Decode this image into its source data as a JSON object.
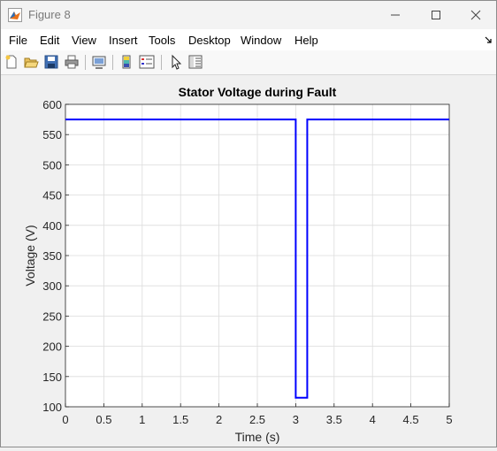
{
  "window": {
    "title": "Figure 8",
    "menu": [
      "File",
      "Edit",
      "View",
      "Insert",
      "Tools",
      "Desktop",
      "Window",
      "Help"
    ]
  },
  "toolbar": {
    "buttons": [
      "new-figure",
      "open-file",
      "save",
      "print",
      "link-figure",
      "insert-colorbar",
      "insert-legend",
      "edit-plot",
      "open-property-inspector"
    ]
  },
  "chart_data": {
    "type": "line",
    "title": "Stator Voltage during Fault",
    "xlabel": "Time (s)",
    "ylabel": "Voltage (V)",
    "xlim": [
      0,
      5
    ],
    "ylim": [
      100,
      600
    ],
    "xticks": [
      "0",
      "0.5",
      "1",
      "1.5",
      "2",
      "2.5",
      "3",
      "3.5",
      "4",
      "4.5",
      "5"
    ],
    "yticks": [
      "100",
      "150",
      "200",
      "250",
      "300",
      "350",
      "400",
      "450",
      "500",
      "550",
      "600"
    ],
    "grid": true,
    "series": [
      {
        "color": "#0000ff",
        "x": [
          0,
          3.0,
          3.0,
          3.15,
          3.15,
          5
        ],
        "y": [
          575,
          575,
          115,
          115,
          575,
          575
        ]
      }
    ]
  }
}
